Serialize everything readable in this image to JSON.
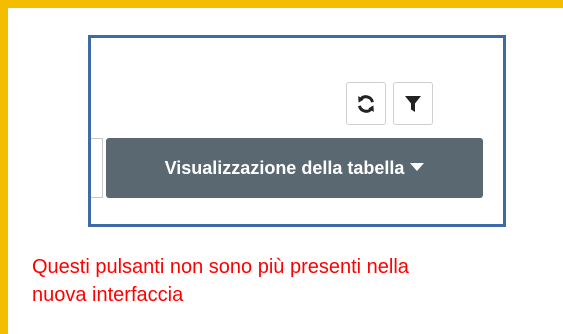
{
  "toolbar": {
    "refresh_icon": "refresh-icon",
    "filter_icon": "filter-icon",
    "table_view_label": "Visualizzazione della tabella",
    "caret_icon": "caret-down-icon"
  },
  "annotation": {
    "text_line1": "Questi pulsanti non sono più presenti nella",
    "text_line2": "nuova interfaccia",
    "frame_color": "#f5bd00",
    "highlight_border_color": "#3f6aa8",
    "text_color": "#ff0000"
  },
  "colors": {
    "dropdown_bg": "#5a6872",
    "dropdown_text": "#ffffff",
    "icon_color": "#222222"
  }
}
